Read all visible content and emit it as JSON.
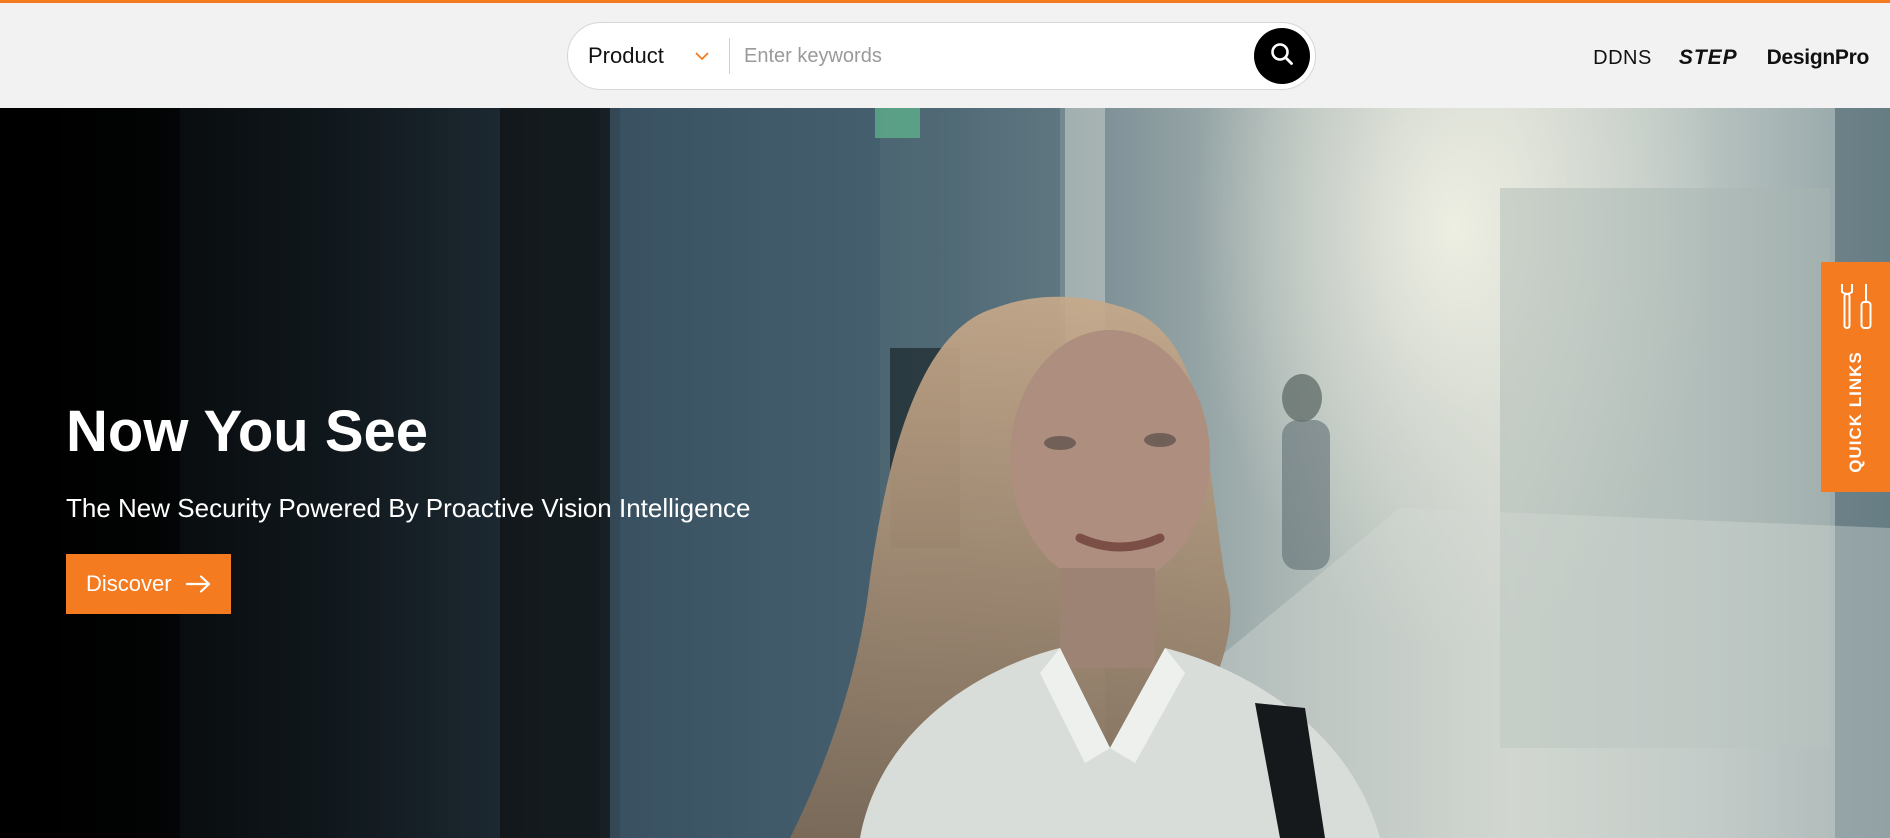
{
  "header": {
    "search": {
      "category_label": "Product",
      "placeholder": "Enter keywords",
      "value": ""
    },
    "brand_links": [
      "DDNS",
      "STEP",
      "DesignPro"
    ]
  },
  "hero": {
    "title": "Now You See",
    "subtitle": "The New Security Powered By Proactive Vision Intelligence",
    "cta_label": "Discover"
  },
  "quick_links": {
    "label": "QUICK LINKS"
  },
  "icons": {
    "category": "chevron-down-icon",
    "search": "search-icon",
    "cta": "arrow-right-icon",
    "quick_links": "tools-icon"
  },
  "colors": {
    "accent": "#f47b20",
    "header_bg": "#f2f2f2",
    "search_button": "#000000",
    "text_light": "#ffffff"
  }
}
